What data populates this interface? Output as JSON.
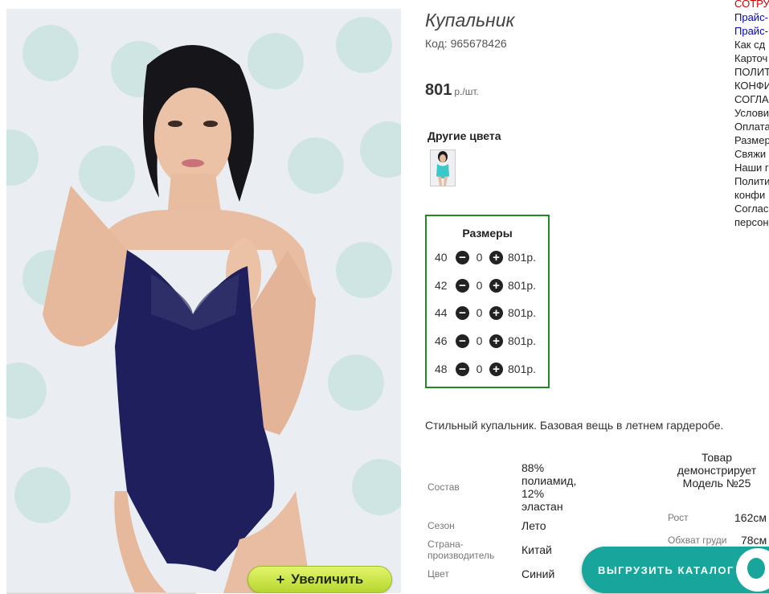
{
  "product": {
    "title": "Купальник",
    "code_label": "Код: 965678426",
    "price_value": "801",
    "price_unit": "р./шт.",
    "zoom_label": "Увеличить",
    "zoom_plus": "+",
    "other_colors_label": "Другие цвета",
    "description": "Стильный купальник. Базовая вещь в летнем гардеробе."
  },
  "sizes": {
    "title": "Размеры",
    "minus": "−",
    "plus": "+",
    "rows": [
      {
        "size": "40",
        "qty": "0",
        "price": "801р."
      },
      {
        "size": "42",
        "qty": "0",
        "price": "801р."
      },
      {
        "size": "44",
        "qty": "0",
        "price": "801р."
      },
      {
        "size": "46",
        "qty": "0",
        "price": "801р."
      },
      {
        "size": "48",
        "qty": "0",
        "price": "801р."
      }
    ]
  },
  "properties": [
    {
      "label": "Состав",
      "value": "88% полиамид, 12% эластан"
    },
    {
      "label": "Сезон",
      "value": "Лето"
    },
    {
      "label": "Страна-производитель",
      "value": "Китай"
    },
    {
      "label": "Цвет",
      "value": "Синий"
    }
  ],
  "model": {
    "heading": "Товар демонстрирует Модель №25",
    "rows": [
      {
        "label": "Рост",
        "value": "162см"
      },
      {
        "label": "Обхват груди",
        "value": "78см"
      }
    ]
  },
  "menu": [
    {
      "text": "СОТРУ",
      "style": "red"
    },
    {
      "text": "Прайс-",
      "style": "blue"
    },
    {
      "text": "Прайс-",
      "style": "blue"
    },
    {
      "text": "Как сд",
      "style": "dark"
    },
    {
      "text": "Карточ",
      "style": "dark"
    },
    {
      "text": "ПОЛИТ",
      "style": "dark"
    },
    {
      "text": "КОНФИ",
      "style": "dark"
    },
    {
      "text": "СОГЛА",
      "style": "dark"
    },
    {
      "text": "Услови",
      "style": "dark"
    },
    {
      "text": "Оплата",
      "style": "dark"
    },
    {
      "text": "Размер",
      "style": "dark"
    },
    {
      "text": "Свяжи",
      "style": "dark"
    },
    {
      "text": "Наши г",
      "style": "dark"
    },
    {
      "text": "Полити",
      "style": "dark"
    },
    {
      "text": "конфи",
      "style": "dark"
    },
    {
      "text": "Соглас",
      "style": "dark"
    },
    {
      "text": "персон",
      "style": "dark"
    }
  ],
  "export": {
    "label": "ВЫГРУЗИТЬ КАТАЛОГ"
  },
  "colors": {
    "frame_green": "#1f8a1f",
    "swimsuit_navy": "#1e1f5c",
    "export_teal": "#17a59c",
    "zoom_green": "#c8e44a"
  }
}
